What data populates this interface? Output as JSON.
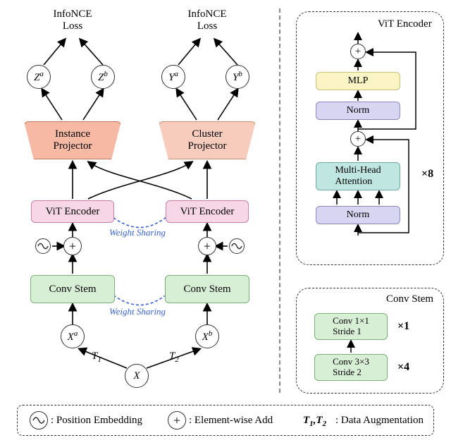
{
  "top": {
    "loss_a": "InfoNCE\nLoss",
    "loss_b": "InfoNCE\nLoss",
    "za": "Z",
    "za_sup": "a",
    "zb": "Z",
    "zb_sup": "b",
    "ya": "Y",
    "ya_sup": "a",
    "yb": "Y",
    "yb_sup": "b"
  },
  "blocks": {
    "inst_proj": "Instance\nProjector",
    "clus_proj": "Cluster\nProjector",
    "vit_enc": "ViT Encoder",
    "conv_stem": "Conv Stem",
    "weight_sharing": "Weight Sharing"
  },
  "inputs": {
    "xa": "X",
    "xa_sup": "a",
    "xb": "X",
    "xb_sup": "b",
    "x": "X",
    "t1": "T",
    "t1_sub": "1",
    "t2": "T",
    "t2_sub": "2"
  },
  "vit_panel": {
    "title": "ViT Encoder",
    "mlp": "MLP",
    "norm": "Norm",
    "mha": "Multi-Head\nAttention",
    "times": "×8"
  },
  "conv_panel": {
    "title": "Conv Stem",
    "conv1": "Conv 1×1\nStride 1",
    "conv1_times": "×1",
    "conv2": "Conv 3×3\nStride 2",
    "conv2_times": "×4"
  },
  "legend": {
    "pos_emb": ": Position Embedding",
    "elem_add": ": Element-wise Add",
    "t12": "T",
    "t1_sub": "1",
    "t2_sub": "2",
    "aug": ": Data Augmentation"
  }
}
